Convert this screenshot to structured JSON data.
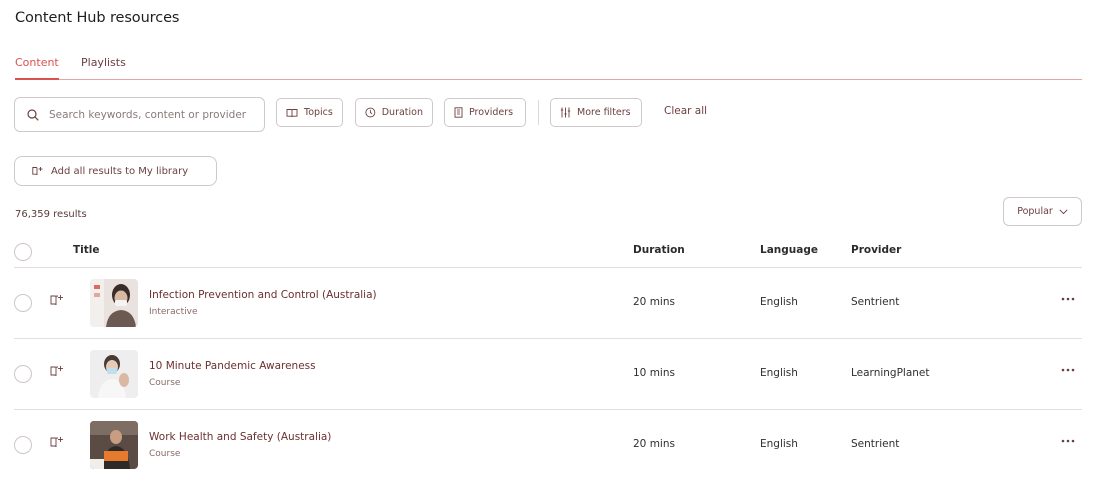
{
  "page": {
    "title": "Content Hub resources"
  },
  "tabs": [
    {
      "label": "Content",
      "active": true
    },
    {
      "label": "Playlists",
      "active": false
    }
  ],
  "search": {
    "placeholder": "Search keywords, content or provider",
    "value": ""
  },
  "filters": {
    "topics": "Topics",
    "duration": "Duration",
    "providers": "Providers",
    "more": "More filters",
    "clear": "Clear all"
  },
  "actions": {
    "add_all": "Add all results to My library"
  },
  "results": {
    "count": "76,359 results"
  },
  "sort": {
    "selected": "Popular"
  },
  "table": {
    "headers": {
      "title": "Title",
      "duration": "Duration",
      "language": "Language",
      "provider": "Provider"
    },
    "rows": [
      {
        "title": "Infection Prevention and Control (Australia)",
        "type": "Interactive",
        "duration": "20 mins",
        "language": "English",
        "provider": "Sentrient"
      },
      {
        "title": "10 Minute Pandemic Awareness",
        "type": "Course",
        "duration": "10 mins",
        "language": "English",
        "provider": "LearningPlanet"
      },
      {
        "title": "Work Health and Safety (Australia)",
        "type": "Course",
        "duration": "20 mins",
        "language": "English",
        "provider": "Sentrient"
      }
    ]
  },
  "colors": {
    "accent": "#d9534f",
    "text_brown": "#6b3e3e",
    "border": "#d0c9c9"
  },
  "icons": [
    "search-icon",
    "book-icon",
    "clock-icon",
    "building-icon",
    "sliders-icon",
    "library-add-icon",
    "chevron-down-icon",
    "more-icon"
  ]
}
